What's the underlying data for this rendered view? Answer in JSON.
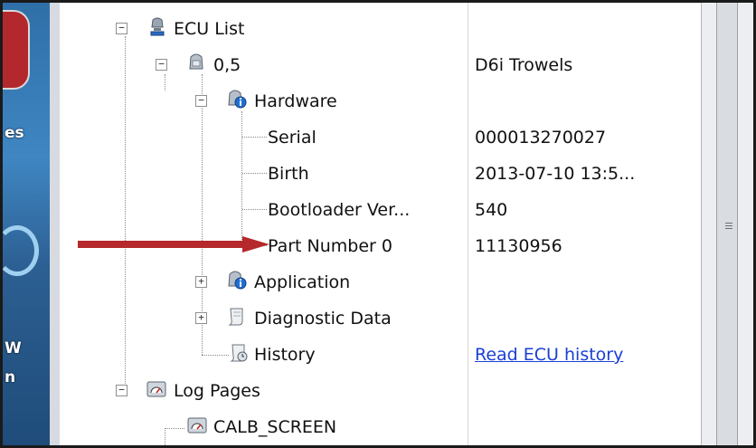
{
  "tree": {
    "ecu_list": {
      "label": "ECU List"
    },
    "ecu": {
      "label": "0,5",
      "value": "D6i Trowels"
    },
    "hardware": {
      "label": "Hardware"
    },
    "serial": {
      "label": "Serial",
      "value": "000013270027"
    },
    "birth": {
      "label": "Birth",
      "value": "2013-07-10 13:5..."
    },
    "bootloader": {
      "label": "Bootloader Ver...",
      "value": "540"
    },
    "part_number": {
      "label": "Part Number 0",
      "value": "11130956"
    },
    "application": {
      "label": "Application"
    },
    "diagnostic": {
      "label": "Diagnostic Data"
    },
    "history": {
      "label": "History",
      "link": "Read ECU history"
    },
    "log_pages": {
      "label": "Log Pages"
    },
    "calb": {
      "label": "CALB_SCREEN"
    }
  },
  "desktop": {
    "text_1": "es",
    "text_2": "W",
    "text_3": "n"
  },
  "scroll": {
    "grip": "≡"
  },
  "colors": {
    "arrow": "#b5282b",
    "link": "#1a40d6"
  },
  "icons": {
    "ecu_list": "network-ecu-icon",
    "ecu": "ecu-node-icon",
    "hardware": "info-ecu-icon",
    "application": "info-ecu-icon",
    "diagnostic": "document-scroll-icon",
    "history": "history-scroll-icon",
    "log_pages": "gauge-icon",
    "calb": "gauge-icon"
  }
}
